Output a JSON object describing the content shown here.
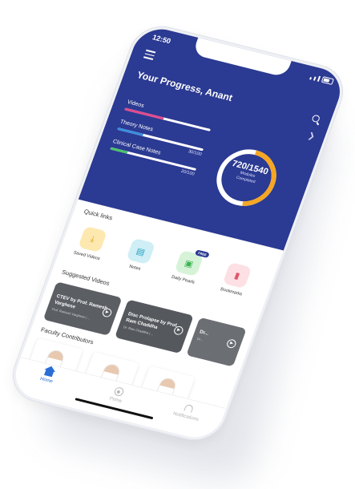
{
  "status": {
    "time": "12:50"
  },
  "header": {
    "title": "Your Progress, Anant"
  },
  "progress": [
    {
      "label": "Videos",
      "count": "",
      "fraction": 0.45,
      "color": "#e24a8d"
    },
    {
      "label": "Theory Notes",
      "count": "30/100",
      "fraction": 0.3,
      "color": "#3b8de0"
    },
    {
      "label": "Clinical Case Notes",
      "count": "20/100",
      "fraction": 0.2,
      "color": "#4cc36b"
    }
  ],
  "ring": {
    "value": "720/1540",
    "sub1": "Modules",
    "sub2": "Completed",
    "fraction": 0.4675,
    "color": "#f5a623"
  },
  "quick_links": {
    "title": "Quick links",
    "items": [
      {
        "label": "Saved Videos",
        "icon": "download-icon",
        "glyph": "⤓",
        "bg": "#fde9b0",
        "fg": "#e0a21a"
      },
      {
        "label": "Notes",
        "icon": "notes-icon",
        "glyph": "▤",
        "bg": "#cfeef5",
        "fg": "#2aa3c4"
      },
      {
        "label": "Daily Pearls",
        "icon": "pearls-icon",
        "glyph": "▣",
        "bg": "#d6f3d8",
        "fg": "#3bb552",
        "badge": "FREE"
      },
      {
        "label": "Bookmarks",
        "icon": "bookmark-icon",
        "glyph": "▮",
        "bg": "#fde0e4",
        "fg": "#e0566c"
      }
    ]
  },
  "suggested": {
    "title": "Suggested Videos",
    "items": [
      {
        "title": "CTEV by Prof. Ramesh Varghese",
        "sub": "Prof. Ramesh Varghese | ...",
        "color": "#5b5e63"
      },
      {
        "title": "Disc Prolapse by Prof. Ram Chaddha",
        "sub": "Dr. Ram Chaddha | ...",
        "color": "#55585d"
      },
      {
        "title": "Dr...",
        "sub": "Dr...",
        "color": "#6b6e73"
      }
    ]
  },
  "contributors": {
    "title": "Faculty Contributors"
  },
  "nav": {
    "home": "Home",
    "prime": "Prime",
    "notifications": "Notifications"
  }
}
